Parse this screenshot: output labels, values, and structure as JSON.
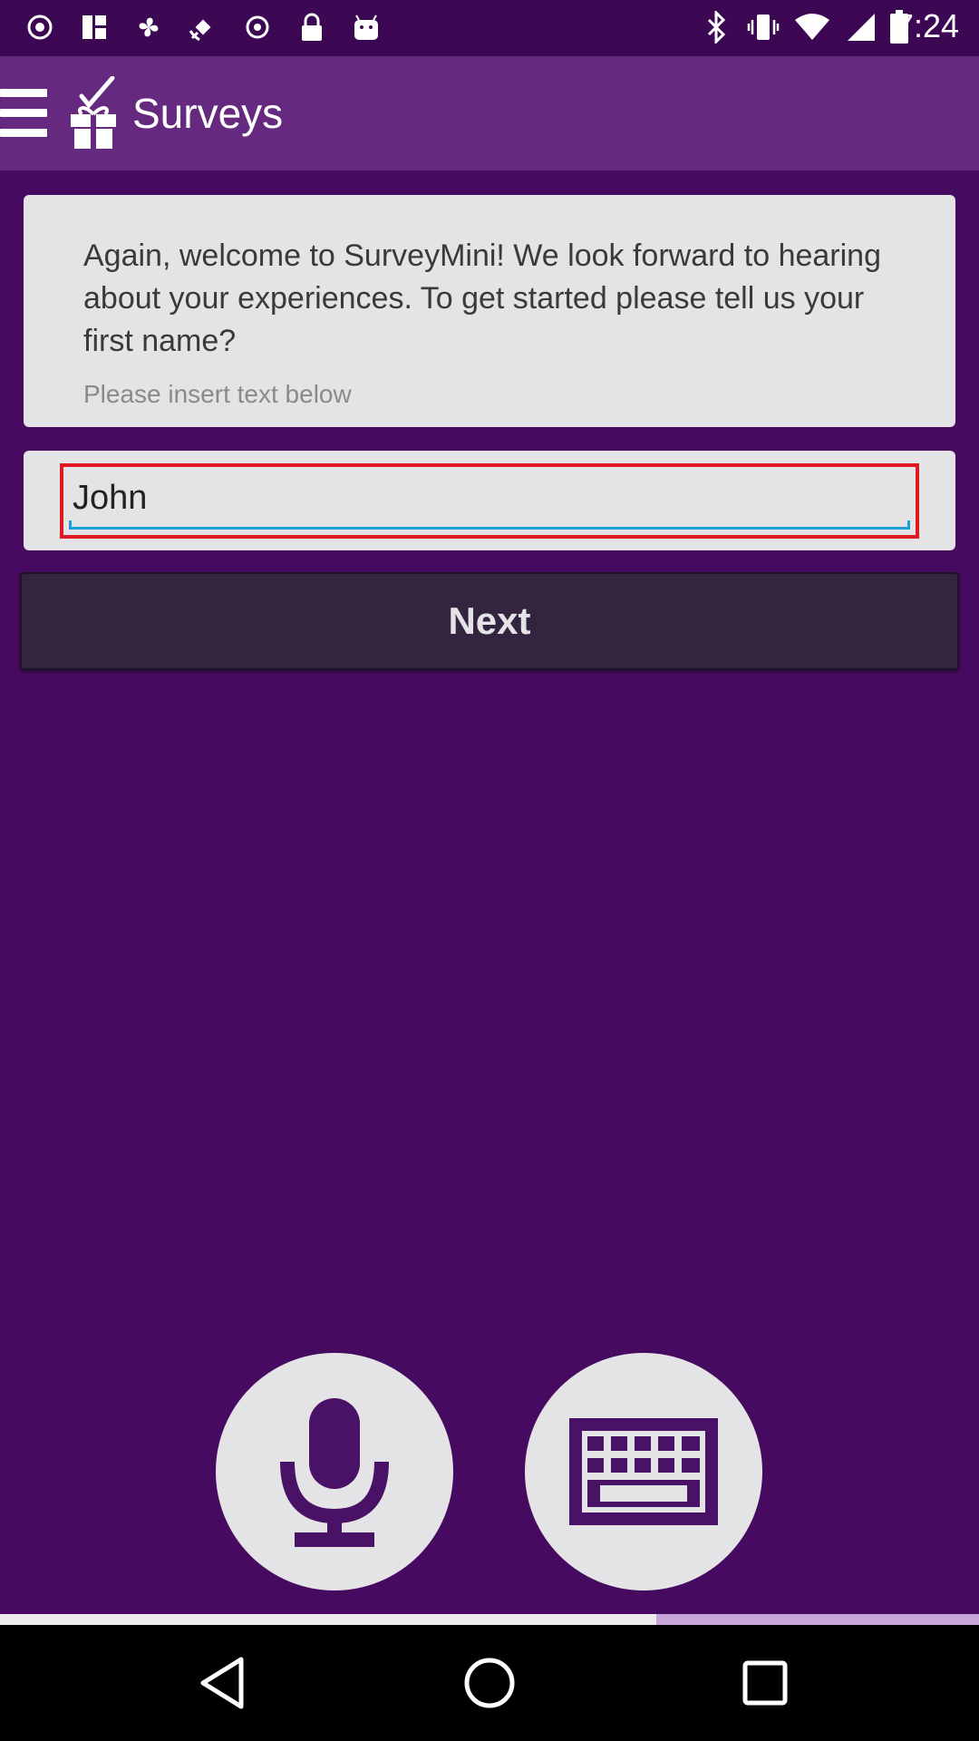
{
  "status_bar": {
    "time": "7:24",
    "left_icons": [
      "record-icon",
      "grid-icon",
      "fan-icon",
      "fake-gps-icon",
      "sync-icon",
      "lock-icon",
      "android-icon"
    ],
    "right_icons": [
      "bluetooth-icon",
      "vibrate-icon",
      "wifi-icon",
      "signal-icon",
      "battery-icon"
    ]
  },
  "app_bar": {
    "title": "Surveys",
    "menu_icon": "hamburger-menu-icon",
    "logo_icon": "gift-check-icon"
  },
  "question": {
    "text": "Again, welcome to SurveyMini! We look forward to hearing about your experiences. To get started please tell us your first name?",
    "hint": "Please insert text below"
  },
  "name_input": {
    "value": "John",
    "placeholder": ""
  },
  "next_button": {
    "label": "Next"
  },
  "input_modes": {
    "voice_icon": "microphone-icon",
    "keyboard_icon": "keyboard-icon"
  },
  "progress": {
    "fraction": 0.67
  },
  "nav_bar": {
    "back_icon": "back-triangle-icon",
    "home_icon": "home-circle-icon",
    "recents_icon": "recents-square-icon"
  },
  "colors": {
    "background": "#460b60",
    "app_bar": "#662980",
    "card": "#e4e4e6",
    "next_button": "#33243f",
    "input_highlight": "#e01a24",
    "input_underline": "#1aa0d8"
  }
}
